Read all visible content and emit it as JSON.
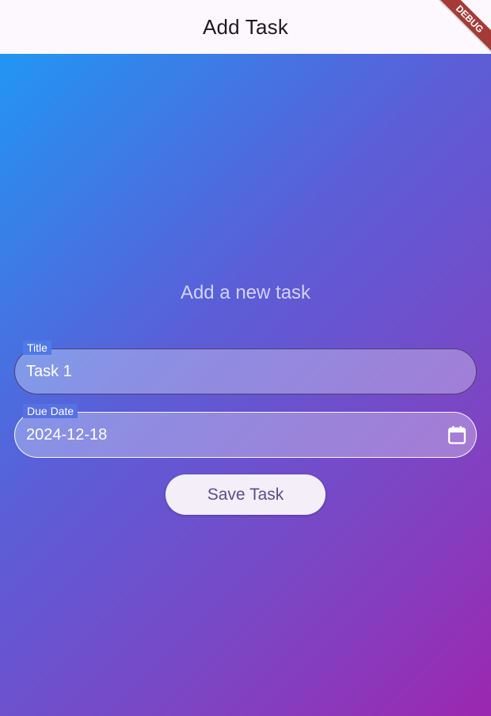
{
  "app_bar": {
    "title": "Add Task"
  },
  "debug_banner": {
    "label": "DEBUG"
  },
  "form": {
    "heading": "Add a new task",
    "title_field": {
      "label": "Title",
      "value": "Task 1"
    },
    "due_date_field": {
      "label": "Due Date",
      "value": "2024-12-18",
      "icon": "calendar-icon"
    },
    "save_button": {
      "label": "Save Task"
    }
  },
  "colors": {
    "app_bar_background": "#fdf7fe",
    "gradient_start": "#2196f3",
    "gradient_end": "#9c27b0",
    "button_background": "#f3eef8",
    "button_text": "#5a4f86",
    "debug_ribbon": "#a43a36"
  }
}
